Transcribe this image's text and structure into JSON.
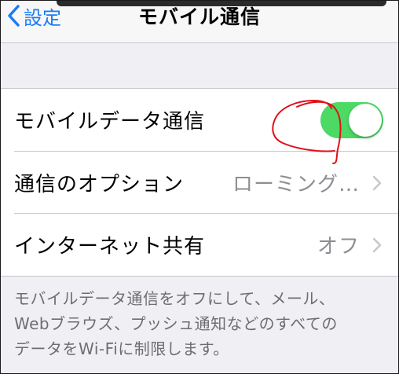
{
  "nav": {
    "back_label": "設定",
    "title": "モバイル通信"
  },
  "rows": [
    {
      "label": "モバイルデータ通信",
      "toggle_on": true
    },
    {
      "label": "通信のオプション",
      "value": "ローミング…"
    },
    {
      "label": "インターネット共有",
      "value": "オフ"
    }
  ],
  "footer": {
    "line1": "モバイルデータ通信をオフにして、メール、",
    "line2": "Webブラウズ、プッシュ通知などのすべての",
    "line3": "データをWi-Fiに制限します。"
  },
  "colors": {
    "accent": "#1a7cf5",
    "toggle_on": "#4cd964",
    "annotation": "#e0101a"
  }
}
